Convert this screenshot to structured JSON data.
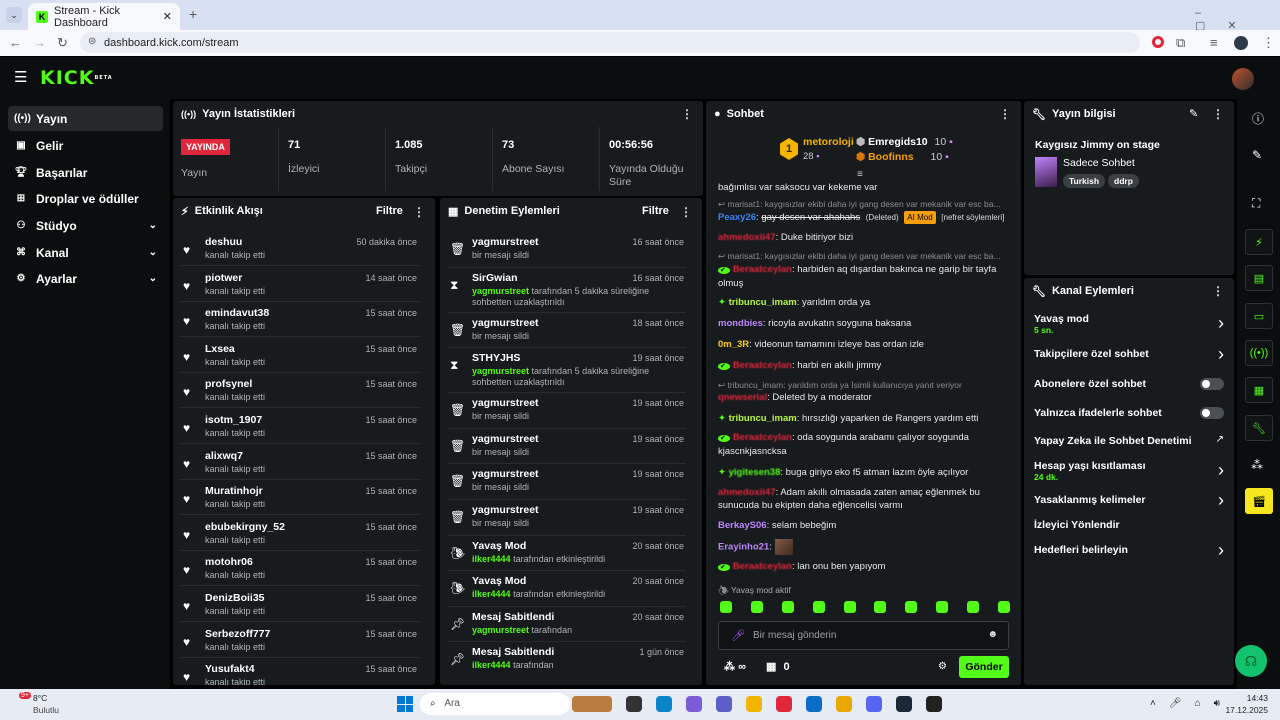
{
  "browser": {
    "tab_title": "Stream - Kick Dashboard",
    "url": "dashboard.kick.com/stream"
  },
  "sidebar": {
    "items": [
      {
        "label": "Yayın",
        "icon": "broadcast-icon"
      },
      {
        "label": "Gelir",
        "icon": "wallet-icon"
      },
      {
        "label": "Başarılar",
        "icon": "trophy-icon"
      },
      {
        "label": "Droplar ve ödüller",
        "icon": "gift-icon"
      },
      {
        "label": "Stüdyo",
        "icon": "studio-icon"
      },
      {
        "label": "Kanal",
        "icon": "channel-icon"
      },
      {
        "label": "Ayarlar",
        "icon": "gear-icon"
      }
    ]
  },
  "stats": {
    "title": "Yayın İstatistikleri",
    "live_badge": "YAYINDA",
    "items": [
      {
        "value": "",
        "label": "Yayın"
      },
      {
        "value": "71",
        "label": "İzleyici"
      },
      {
        "value": "1.085",
        "label": "Takipçi"
      },
      {
        "value": "73",
        "label": "Abone Sayısı"
      },
      {
        "value": "00:56:56",
        "label": "Yayında Olduğu Süre"
      }
    ]
  },
  "activity": {
    "title": "Etkinlik Akışı",
    "filter": "Filtre",
    "sub": "kanalı takip etti",
    "rows": [
      {
        "name": "deshuu",
        "time": "50 dakika önce"
      },
      {
        "name": "piotwer",
        "time": "14 saat önce"
      },
      {
        "name": "emindavut38",
        "time": "15 saat önce"
      },
      {
        "name": "Lxsea",
        "time": "15 saat önce"
      },
      {
        "name": "profsynel",
        "time": "15 saat önce"
      },
      {
        "name": "isotm_1907",
        "time": "15 saat önce"
      },
      {
        "name": "alixwq7",
        "time": "15 saat önce"
      },
      {
        "name": "Muratinhojr",
        "time": "15 saat önce"
      },
      {
        "name": "ebubekirgny_52",
        "time": "15 saat önce"
      },
      {
        "name": "motohr06",
        "time": "15 saat önce"
      },
      {
        "name": "DenizBoii35",
        "time": "15 saat önce"
      },
      {
        "name": "Serbezoff777",
        "time": "15 saat önce"
      },
      {
        "name": "Yusufakt4",
        "time": "15 saat önce"
      }
    ]
  },
  "moderation": {
    "title": "Denetim Eylemleri",
    "filter": "Filtre",
    "rows": [
      {
        "icon": "trash-icon",
        "name": "yagmurstreet",
        "sub": "bir mesajı sildi",
        "time": "16 saat önce"
      },
      {
        "icon": "hourglass-icon",
        "name": "SirGwian",
        "sub_user": "yagmurstreet",
        "sub": "tarafından 5 dakika süreliğine sohbetten uzaklaştırıldı",
        "time": "16 saat önce"
      },
      {
        "icon": "trash-icon",
        "name": "yagmurstreet",
        "sub": "bir mesajı sildi",
        "time": "18 saat önce"
      },
      {
        "icon": "hourglass-icon",
        "name": "STHYJHS",
        "sub_user": "yagmurstreet",
        "sub": "tarafından 5 dakika süreliğine sohbetten uzaklaştırıldı",
        "time": "19 saat önce"
      },
      {
        "icon": "trash-icon",
        "name": "yagmurstreet",
        "sub": "bir mesajı sildi",
        "time": "19 saat önce"
      },
      {
        "icon": "trash-icon",
        "name": "yagmurstreet",
        "sub": "bir mesajı sildi",
        "time": "19 saat önce"
      },
      {
        "icon": "trash-icon",
        "name": "yagmurstreet",
        "sub": "bir mesajı sildi",
        "time": "19 saat önce"
      },
      {
        "icon": "trash-icon",
        "name": "yagmurstreet",
        "sub": "bir mesajı sildi",
        "time": "19 saat önce"
      },
      {
        "icon": "snail-icon",
        "name": "Yavaş Mod",
        "sub_user": "ilker4444",
        "sub": "tarafından etkinleştirildi",
        "time": "20 saat önce"
      },
      {
        "icon": "snail-icon",
        "name": "Yavaş Mod",
        "sub_user": "ilker4444",
        "sub": "tarafından etkinleştirildi",
        "time": "20 saat önce"
      },
      {
        "icon": "pin-icon",
        "name": "Mesaj Sabitlendi",
        "sub_user": "yagmurstreet",
        "sub": "tarafından",
        "time": "20 saat önce"
      },
      {
        "icon": "pin-icon",
        "name": "Mesaj Sabitlendi",
        "sub_user": "ilker4444",
        "sub": "tarafından",
        "time": "1 gün önce"
      }
    ]
  },
  "chat": {
    "title": "Sohbet",
    "leader": {
      "name": "metoroloji",
      "points": "28",
      "u2": "Emregids10",
      "p2": "10",
      "u3": "Boofinns",
      "p3": "10"
    },
    "messages": [
      {
        "type": "text",
        "text": "bağımlısı var saksocu var kekeme var"
      },
      {
        "type": "reply",
        "text": "marisat1: kaygısızlar ekibi daha iyi gang desen var mekanik var esc ba..."
      },
      {
        "type": "msg",
        "user": "Peaxy26",
        "color": "#3b82f6",
        "text": "gay desen var ahahahs",
        "tags": [
          "(Deleted)",
          "AI Mod",
          "[nefret söylemleri]"
        ]
      },
      {
        "type": "msg",
        "user": "ahmedoxii47",
        "color": "#e0263a",
        "text": "Duke bitiriyor bizi"
      },
      {
        "type": "reply",
        "text": "marisat1: kaygısızlar ekibi daha iyi gang desen var mekanik var esc ba..."
      },
      {
        "type": "msg",
        "user": "Beraatceylan",
        "color": "#e0263a",
        "text": "harbiden aq dışardan bakınca ne garip bir tayfa olmuş"
      },
      {
        "type": "msg",
        "user": "tribuncu_imam",
        "color": "#b7f542",
        "text": "yarıldım orda ya"
      },
      {
        "type": "msg",
        "user": "mondbies",
        "color": "#c084fc",
        "text": "ricoyla avukatın soyguna baksana"
      },
      {
        "type": "msg",
        "user": "0m_3R",
        "color": "#facc15",
        "text": "videonun tamamını izleye bas ordan izle"
      },
      {
        "type": "msg",
        "user": "Beraatceylan",
        "color": "#e0263a",
        "text": "harbi en akıllı jimmy"
      },
      {
        "type": "reply",
        "text": "tribuncu_imam: yarıldım orda ya İsimli kullanıcıya yanıt veriyor"
      },
      {
        "type": "msg",
        "user": "qnewserial",
        "color": "#e0263a",
        "text": "Deleted by a moderator"
      },
      {
        "type": "msg",
        "user": "tribuncu_imam",
        "color": "#b7f542",
        "text": "hırsızlığı yaparken de Rangers yardım etti"
      },
      {
        "type": "msg",
        "user": "Beraatceylan",
        "color": "#e0263a",
        "text": "oda soygunda arabamı çalıyor soygunda kjascnkjasncksa"
      },
      {
        "type": "msg",
        "user": "yigitesen38",
        "color": "#53fc18",
        "text": "buga giriyo eko f5 atman lazım öyle açılıyor"
      },
      {
        "type": "msg",
        "user": "ahmedoxii47",
        "color": "#e0263a",
        "text": "Adam akıllı olmasada zaten amaç eğlenmek bu sunucuda bu ekipten daha eğlencelisi varmı"
      },
      {
        "type": "msg",
        "user": "BerkayS06",
        "color": "#c084fc",
        "text": "selam bebeğim"
      },
      {
        "type": "msg",
        "user": "Erayinho21",
        "color": "#c084fc",
        "text": ""
      },
      {
        "type": "msg",
        "user": "Beraatceylan",
        "color": "#e0263a",
        "text": "lan onu ben yapıyom"
      }
    ],
    "slow_mode": "Yavaş mod aktif",
    "placeholder": "Bir mesaj gönderin",
    "send": "Gönder",
    "infinity": "∞",
    "count": "0"
  },
  "info": {
    "title": "Yayın bilgisi",
    "stream_title": "Kaygısız Jimmy on stage",
    "category": "Sadece Sohbet",
    "tags": [
      "Turkish",
      "ddrp"
    ]
  },
  "actions": {
    "title": "Kanal Eylemleri",
    "items": [
      {
        "label": "Yavaş mod",
        "sub": "5 sn.",
        "control": "arrow"
      },
      {
        "label": "Takipçilere özel sohbet",
        "sub": "",
        "control": "arrow"
      },
      {
        "label": "Abonelere özel sohbet",
        "sub": "",
        "control": "toggle"
      },
      {
        "label": "Yalnızca ifadelerle sohbet",
        "sub": "",
        "control": "toggle"
      },
      {
        "label": "Yapay Zeka ile Sohbet Denetimi",
        "sub": "",
        "control": "external"
      },
      {
        "label": "Hesap yaşı kısıtlaması",
        "sub": "24 dk.",
        "control": "arrow"
      },
      {
        "label": "Yasaklanmış kelimeler",
        "sub": "",
        "control": "arrow"
      },
      {
        "label": "İzleyici Yönlendir",
        "sub": "",
        "control": "none"
      },
      {
        "label": "Hedefleri belirleyin",
        "sub": "",
        "control": "arrow"
      }
    ]
  },
  "taskbar": {
    "weather_temp": "8°C",
    "weather_text": "Bulutlu",
    "search": "Ara",
    "time": "14:43",
    "date": "17.12.2025",
    "badge": "9+"
  }
}
